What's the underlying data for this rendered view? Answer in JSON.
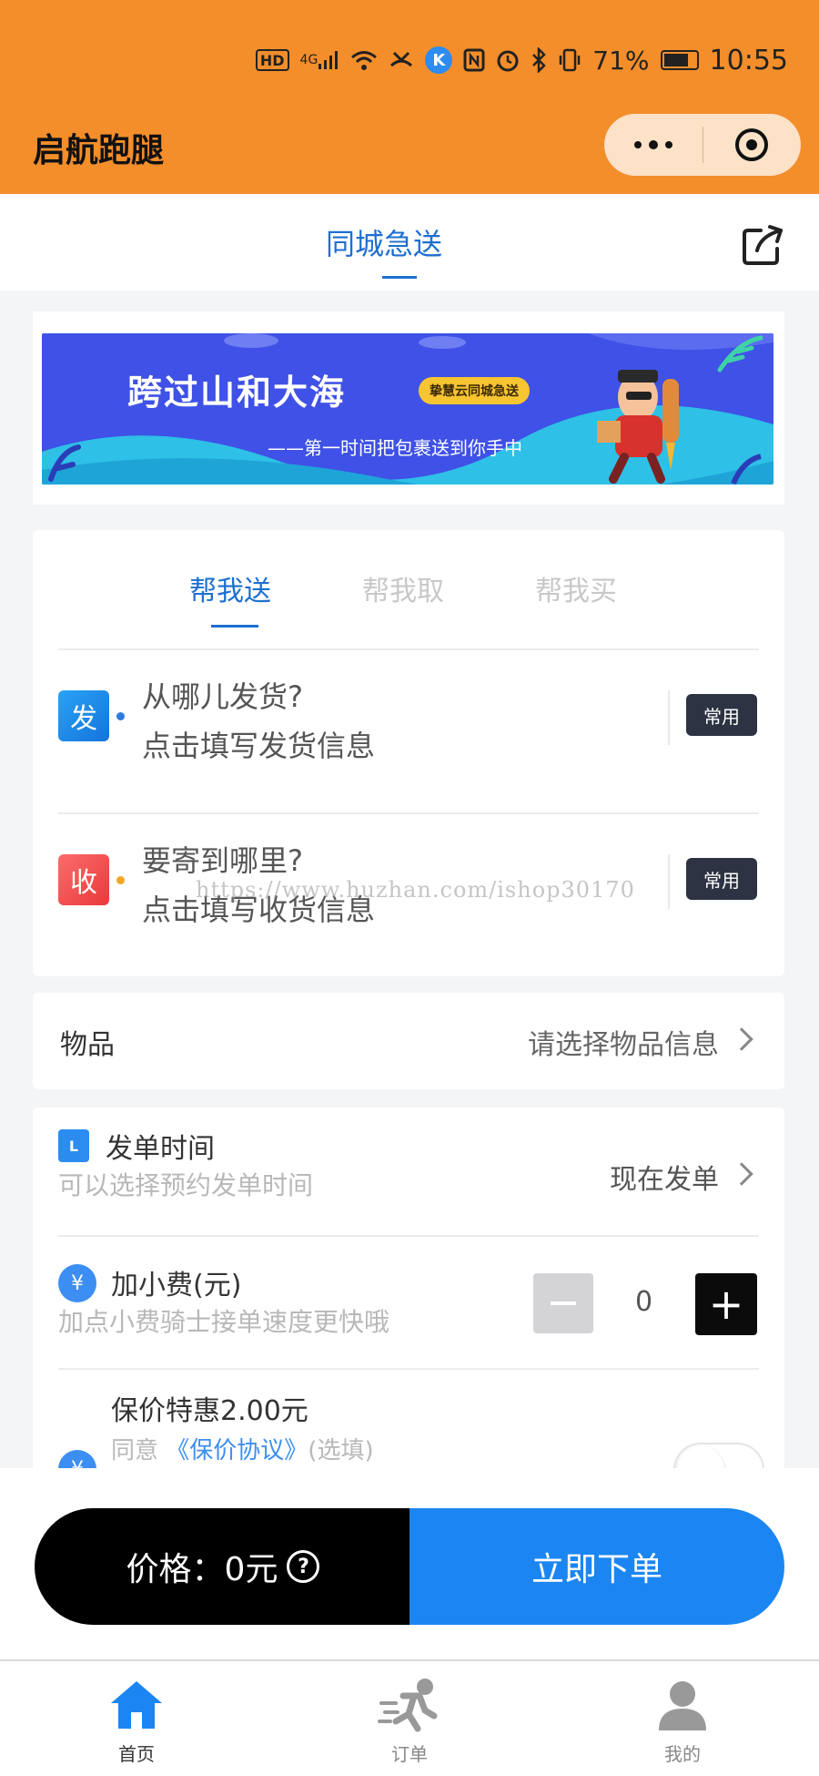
{
  "status_bar": {
    "network": "4G",
    "battery": "71%",
    "time": "10:55"
  },
  "header": {
    "app_title": "启航跑腿"
  },
  "top_tab": {
    "label": "同城急送"
  },
  "banner": {
    "headline": "跨过山和大海",
    "tag": "挚慧云同城急送",
    "slogan": "——第一时间把包裹送到你手中"
  },
  "service_tabs": [
    {
      "label": "帮我送",
      "active": true
    },
    {
      "label": "帮我取",
      "active": false
    },
    {
      "label": "帮我买",
      "active": false
    }
  ],
  "sender": {
    "badge": "发",
    "question": "从哪儿发货?",
    "hint": "点击填写发货信息",
    "common_label": "常用"
  },
  "receiver": {
    "badge": "收",
    "question": "要寄到哪里?",
    "hint": "点击填写收货信息",
    "common_label": "常用"
  },
  "watermark": "https://www.huzhan.com/ishop30170",
  "goods": {
    "label": "物品",
    "value": "请选择物品信息"
  },
  "order_time": {
    "icon_text": "L",
    "title": "发单时间",
    "subtitle": "可以选择预约发单时间",
    "value": "现在发单"
  },
  "tip": {
    "icon_text": "¥",
    "title": "加小费(元)",
    "subtitle": "加点小费骑士接单速度更快哦",
    "value": "0"
  },
  "insurance": {
    "title": "保价特惠2.00元",
    "agree_prefix": "同意",
    "agree_link": "《保价协议》",
    "agree_suffix": "(选填)",
    "enabled": false
  },
  "order_bar": {
    "price_label": "价格：0元",
    "help_icon": "?",
    "submit_label": "立即下单"
  },
  "bottom_nav": [
    {
      "label": "首页",
      "icon": "home-icon",
      "active": true
    },
    {
      "label": "订单",
      "icon": "runner-icon",
      "active": false
    },
    {
      "label": "我的",
      "icon": "user-icon",
      "active": false
    }
  ],
  "colors": {
    "header_orange": "#f38e2b",
    "brand_blue": "#1e6fd0",
    "submit_blue": "#1b86f2"
  }
}
